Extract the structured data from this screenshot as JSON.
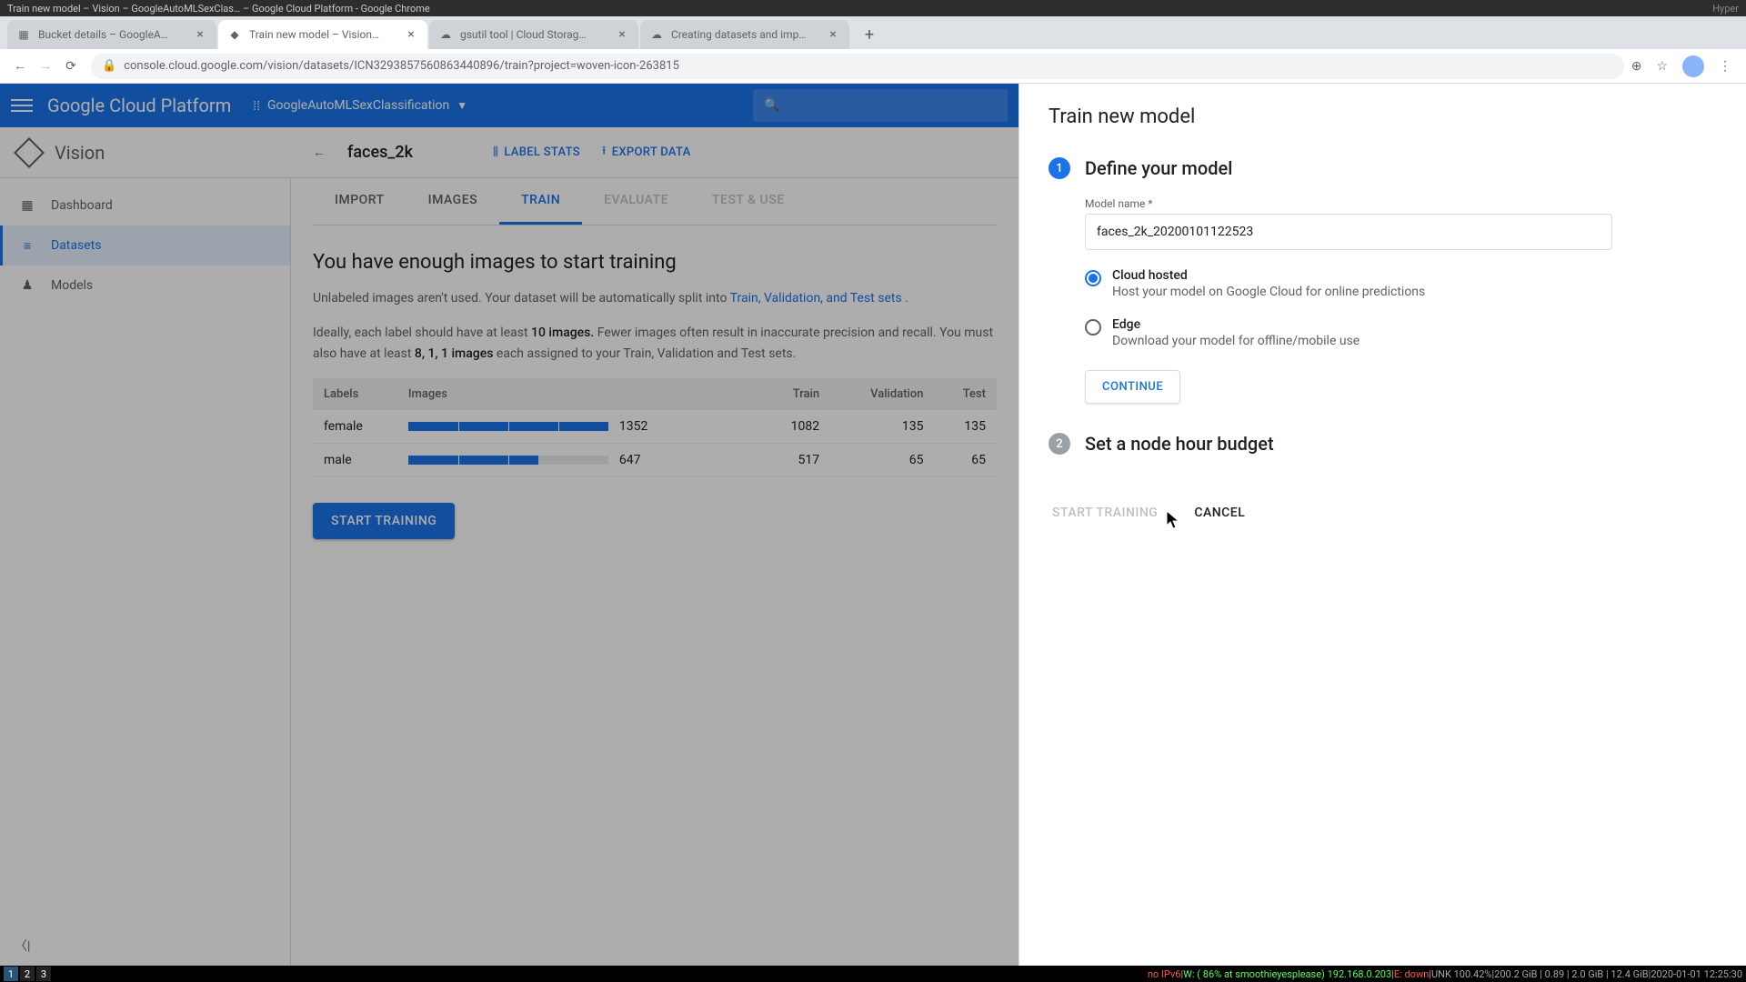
{
  "os": {
    "title_left": "Train new model – Vision – GoogleAutoMLSexClas… – Google Cloud Platform - Google Chrome",
    "title_right": "Hyper"
  },
  "tabs": [
    {
      "title": "Bucket details – GoogleA…"
    },
    {
      "title": "Train new model – Vision…"
    },
    {
      "title": "gsutil tool  |  Cloud Storag…"
    },
    {
      "title": "Creating datasets and imp…"
    }
  ],
  "url": "console.cloud.google.com/vision/datasets/ICN3293857560863440896/train?project=woven-icon-263815",
  "gcp": {
    "logo": "Google Cloud Platform",
    "project": "GoogleAutoMLSexClassification"
  },
  "vision": {
    "brand": "Vision",
    "dataset": "faces_2k",
    "actions": {
      "label_stats": "LABEL STATS",
      "export": "EXPORT DATA"
    }
  },
  "sidebar": {
    "dashboard": "Dashboard",
    "datasets": "Datasets",
    "models": "Models"
  },
  "tabs_inner": {
    "import": "IMPORT",
    "images": "IMAGES",
    "train": "TRAIN",
    "evaluate": "EVALUATE",
    "test": "TEST & USE"
  },
  "content": {
    "heading": "You have enough images to start training",
    "p1a": "Unlabeled images aren't used. Your dataset will be automatically split into ",
    "p1link": "Train, Validation, and Test sets",
    "p1b": " .",
    "p2a": "Ideally, each label should have at least ",
    "p2bold1": "10 images.",
    "p2b": " Fewer images often result in inaccurate precision and recall. You must also have at least ",
    "p2bold2": "8, 1, 1 images",
    "p2c": " each assigned to your Train, Validation and Test sets.",
    "start": "START TRAINING"
  },
  "table": {
    "headers": {
      "labels": "Labels",
      "images": "Images",
      "train": "Train",
      "validation": "Validation",
      "test": "Test"
    },
    "rows": [
      {
        "label": "female",
        "images": "1352",
        "train": "1082",
        "validation": "135",
        "test": "135",
        "pct": 100
      },
      {
        "label": "male",
        "images": "647",
        "train": "517",
        "validation": "65",
        "test": "65",
        "pct": 65
      }
    ]
  },
  "panel": {
    "title": "Train new model",
    "step1": {
      "num": "1",
      "title": "Define your model"
    },
    "model_name_label": "Model name *",
    "model_name_value": "faces_2k_20200101122523",
    "radio_cloud": {
      "title": "Cloud hosted",
      "desc": "Host your model on Google Cloud for online predictions"
    },
    "radio_edge": {
      "title": "Edge",
      "desc": "Download your model for offline/mobile use"
    },
    "continue": "CONTINUE",
    "step2": {
      "num": "2",
      "title": "Set a node hour budget"
    },
    "start": "START TRAINING",
    "cancel": "CANCEL"
  },
  "status": {
    "ipv6": "no IPv6",
    "w": "W: ( 86% at smoothieyesplease) 192.168.0.203",
    "e": "E: down",
    "unk": "UNK 100.42%",
    "mem": "200.2 GiB | 0.89 | 2.0 GiB   |  12.4 GiB",
    "time": "2020-01-01 12:25:30"
  }
}
